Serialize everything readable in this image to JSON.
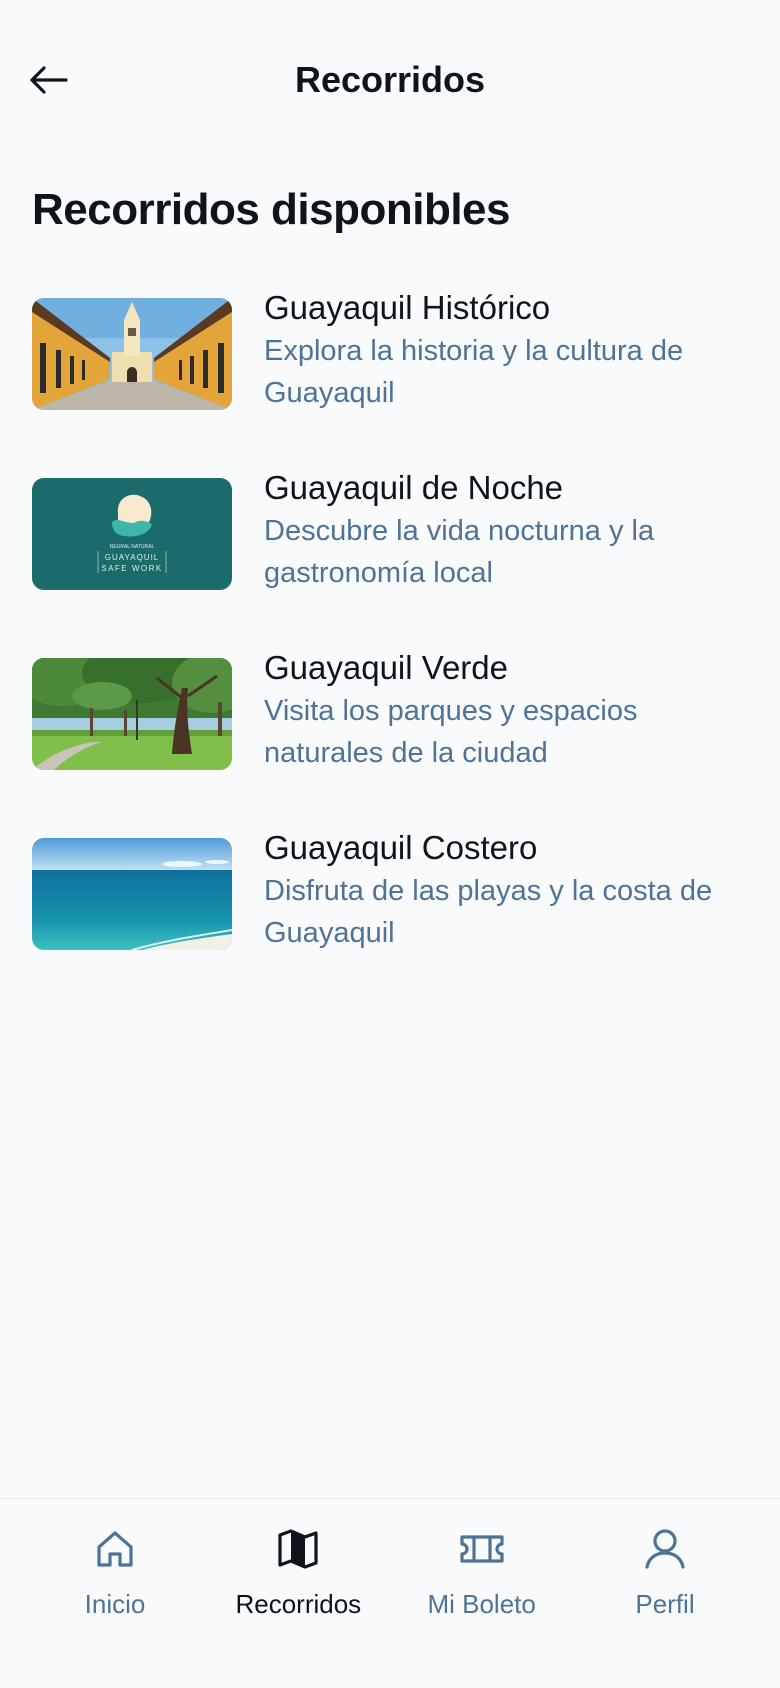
{
  "header": {
    "title": "Recorridos",
    "back_icon": "arrow-left-icon"
  },
  "section": {
    "title": "Recorridos disponibles"
  },
  "tours": [
    {
      "name": "Guayaquil Histórico",
      "description": "Explora la historia y la cultura de Guayaquil",
      "image": "historic-street-church-image"
    },
    {
      "name": "Guayaquil de Noche",
      "description": "Descubre la vida nocturna y la gastronomía local",
      "image": "guayaquil-safe-work-logo-image",
      "logo_text": [
        "NEURAL NATURAL",
        "GUAYAQUIL",
        "SAFE WORK"
      ]
    },
    {
      "name": "Guayaquil Verde",
      "description": "Visita los parques y espacios naturales de la ciudad",
      "image": "park-trees-image"
    },
    {
      "name": "Guayaquil Costero",
      "description": "Disfruta de las playas y la costa de Guayaquil",
      "image": "ocean-beach-image"
    }
  ],
  "nav": [
    {
      "label": "Inicio",
      "icon": "home-icon",
      "active": false
    },
    {
      "label": "Recorridos",
      "icon": "map-icon",
      "active": true
    },
    {
      "label": "Mi Boleto",
      "icon": "ticket-icon",
      "active": false
    },
    {
      "label": "Perfil",
      "icon": "user-icon",
      "active": false
    }
  ],
  "colors": {
    "background": "#f8fafc",
    "text_primary": "#0e141b",
    "text_secondary": "#4e7397",
    "logo_bg": "#1a6b6a"
  }
}
